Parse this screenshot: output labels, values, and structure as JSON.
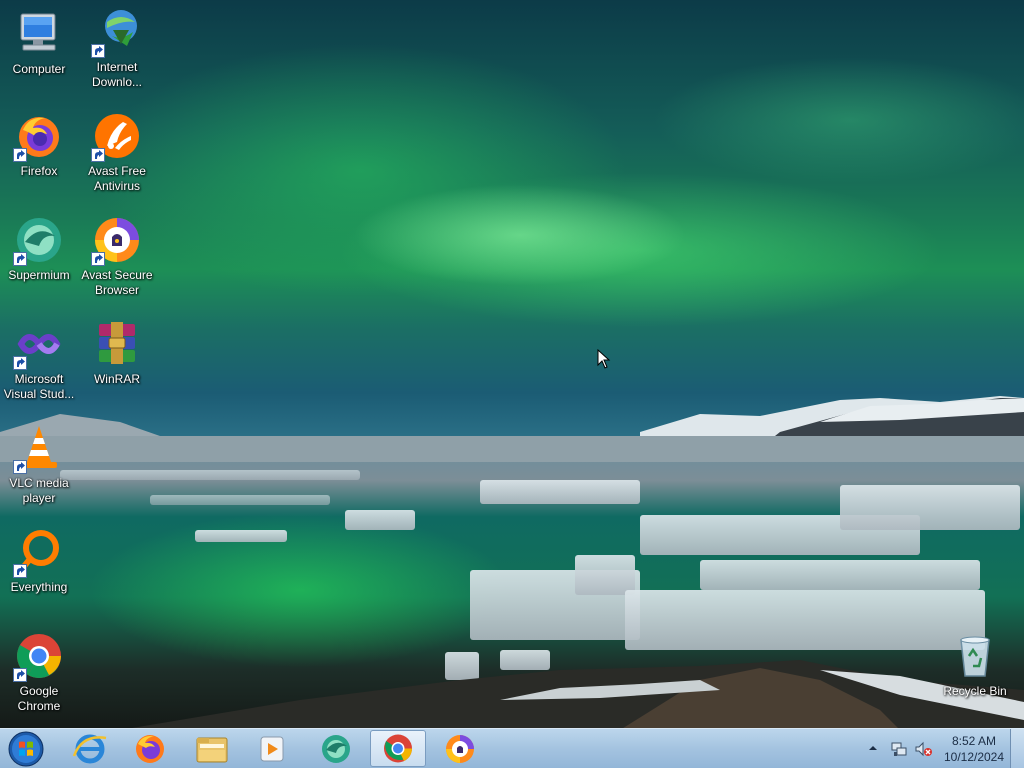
{
  "desktop": {
    "icons": [
      {
        "label": "Computer"
      },
      {
        "label": "Internet Downlo..."
      },
      {
        "label": "Firefox"
      },
      {
        "label": "Avast Free Antivirus"
      },
      {
        "label": "Supermium"
      },
      {
        "label": "Avast Secure Browser"
      },
      {
        "label": "Microsoft Visual Stud..."
      },
      {
        "label": "WinRAR"
      },
      {
        "label": "VLC media player"
      },
      {
        "label": "Everything"
      },
      {
        "label": "Google Chrome"
      },
      {
        "label": "Recycle Bin"
      }
    ]
  },
  "taskbar": {
    "pinned": [
      {
        "icon": "internet-explorer-icon"
      },
      {
        "icon": "firefox-icon"
      },
      {
        "icon": "file-explorer-icon"
      },
      {
        "icon": "media-player-icon"
      },
      {
        "icon": "supermium-icon"
      },
      {
        "icon": "chrome-icon",
        "active": true
      },
      {
        "icon": "avast-secure-browser-icon"
      }
    ],
    "clock": {
      "time": "8:52 AM",
      "date": "10/12/2024"
    }
  },
  "colors": {
    "taskbar": "#a4c3e0",
    "aurora": "#2fd36a",
    "water": "#127055"
  }
}
